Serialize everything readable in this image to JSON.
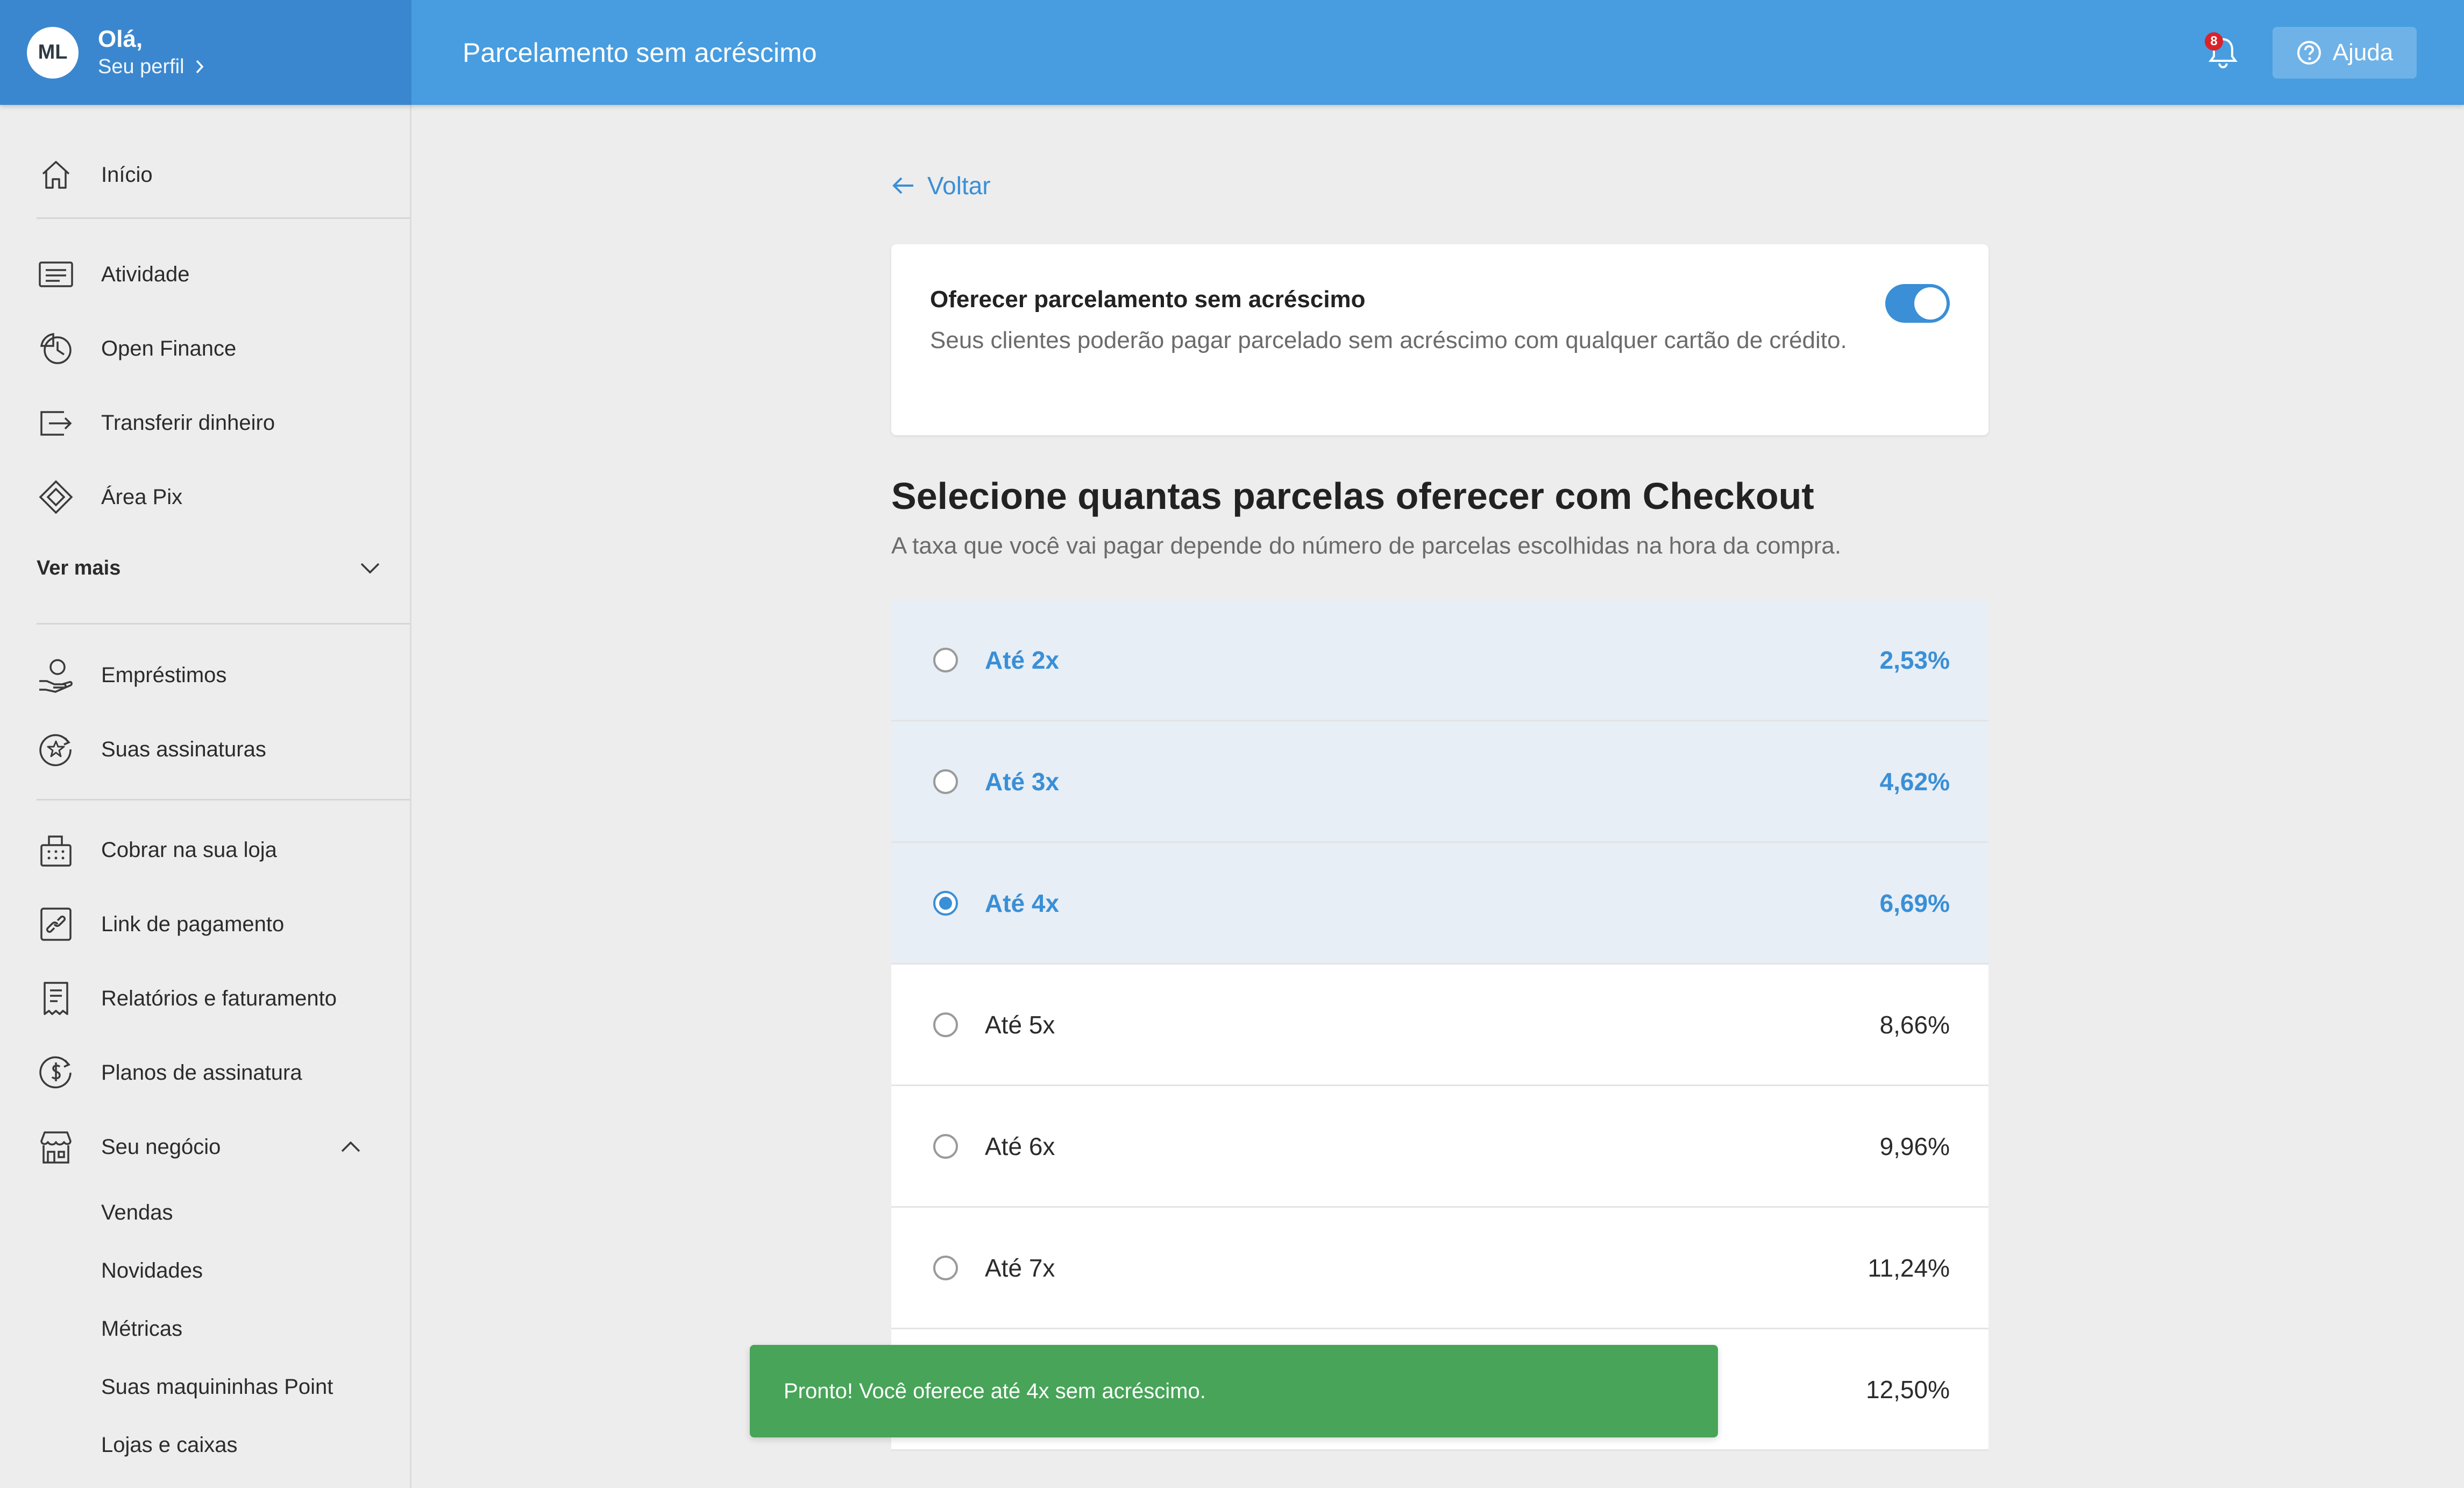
{
  "header": {
    "avatar_initials": "ML",
    "greeting": "Olá,",
    "profile_link": "Seu perfil",
    "title": "Parcelamento sem acréscimo",
    "notification_count": "8",
    "help_label": "Ajuda",
    "colors": {
      "profile_bg": "#3b87cf",
      "bar_bg": "#479ddf"
    }
  },
  "sidebar": {
    "home": {
      "label": "Início",
      "icon": "home-icon"
    },
    "group1": [
      {
        "label": "Atividade",
        "icon": "activity-icon"
      },
      {
        "label": "Open Finance",
        "icon": "open-finance-icon"
      },
      {
        "label": "Transferir dinheiro",
        "icon": "transfer-icon"
      },
      {
        "label": "Área Pix",
        "icon": "pix-icon"
      }
    ],
    "more_label": "Ver mais",
    "group2": [
      {
        "label": "Empréstimos",
        "icon": "loan-icon"
      },
      {
        "label": "Suas assinaturas",
        "icon": "subscriptions-icon"
      }
    ],
    "group3": [
      {
        "label": "Cobrar na sua loja",
        "icon": "register-icon"
      },
      {
        "label": "Link de pagamento",
        "icon": "link-icon"
      },
      {
        "label": "Relatórios e faturamento",
        "icon": "report-icon"
      },
      {
        "label": "Planos de assinatura",
        "icon": "plans-icon"
      }
    ],
    "business": {
      "label": "Seu negócio",
      "icon": "store-icon",
      "children": [
        "Vendas",
        "Novidades",
        "Métricas",
        "Suas maquininhas Point",
        "Lojas e caixas"
      ]
    }
  },
  "main": {
    "back_label": "Voltar",
    "toggle_card": {
      "title": "Oferecer parcelamento sem acréscimo",
      "description": "Seus clientes poderão pagar parcelado sem acréscimo com qualquer cartão de crédito.",
      "enabled": true
    },
    "section_title": "Selecione quantas parcelas oferecer com Checkout",
    "section_subtitle": "A taxa que você vai pagar depende do número de parcelas escolhidas na hora da compra.",
    "options": [
      {
        "label": "Até 2x",
        "rate": "2,53%",
        "highlighted": true,
        "selected": false
      },
      {
        "label": "Até 3x",
        "rate": "4,62%",
        "highlighted": true,
        "selected": false
      },
      {
        "label": "Até 4x",
        "rate": "6,69%",
        "highlighted": true,
        "selected": true
      },
      {
        "label": "Até 5x",
        "rate": "8,66%",
        "highlighted": false,
        "selected": false
      },
      {
        "label": "Até 6x",
        "rate": "9,96%",
        "highlighted": false,
        "selected": false
      },
      {
        "label": "Até 7x",
        "rate": "11,24%",
        "highlighted": false,
        "selected": false
      },
      {
        "label": "",
        "rate": "12,50%",
        "highlighted": false,
        "selected": false
      }
    ],
    "accent_color": "#3a8fd6"
  },
  "toast": {
    "message": "Pronto! Você oferece até 4x sem acréscimo.",
    "color": "#47a458"
  }
}
